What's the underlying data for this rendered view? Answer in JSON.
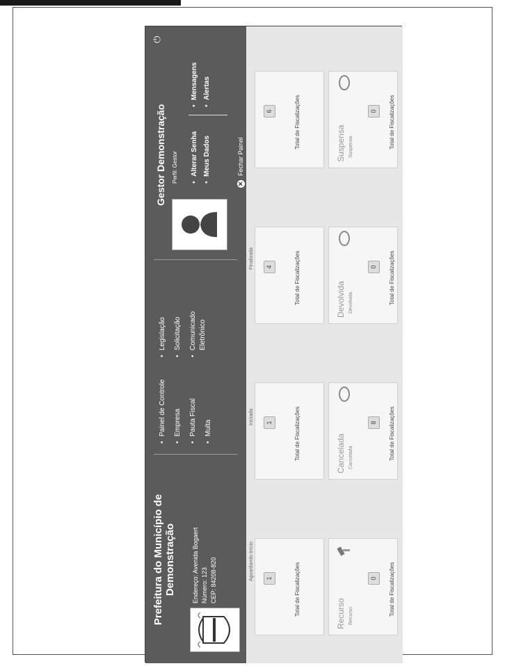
{
  "prefeitura": {
    "title": "Prefeitura do Município de Demonstração",
    "endereco": "Endereço:  Avenida Bogaert",
    "numero": "Número: 123",
    "cep": "CEP: 84208-820"
  },
  "menu1": [
    "Painel de Controle",
    "Empresa",
    "Pauta Fiscal",
    "Multa"
  ],
  "menu2": [
    "Legislação",
    "Solicitação",
    "Comunicado Eletrônico"
  ],
  "gestor": {
    "name": "Gestor Demonstração",
    "perfil": "Perfil: Gestor",
    "links_left": [
      "Alterar Senha",
      "Meus Dados"
    ],
    "links_right": [
      "Mensagens",
      "Alertas"
    ],
    "fechar": "Fechar Painel"
  },
  "cards": [
    {
      "status": "",
      "small": "Aguardando Início",
      "count": "1",
      "total": "Total de Fiscalizações"
    },
    {
      "status": "",
      "small": "Iniciada",
      "count": "1",
      "total": "Total de Fiscalizações"
    },
    {
      "status": "",
      "small": "Finalizada",
      "count": "4",
      "total": "Total de Fiscalizações"
    },
    {
      "status": "",
      "small": "",
      "count": "6",
      "total": "Total de Fiscalizações"
    },
    {
      "status": "Recurso",
      "small": "Recurso",
      "count": "0",
      "total": "Total de Fiscalizações"
    },
    {
      "status": "Cancelada",
      "small": "Cancelada",
      "count": "8",
      "total": "Total de Fiscalizações"
    },
    {
      "status": "Devolvida",
      "small": "Devolvida",
      "count": "0",
      "total": "Total de Fiscalizações"
    },
    {
      "status": "Suspensa",
      "small": "Suspensa",
      "count": "0",
      "total": "Total de Fiscalizações"
    }
  ],
  "colors": {
    "panel": "#5b5b5b",
    "content": "#e6e6e6"
  }
}
